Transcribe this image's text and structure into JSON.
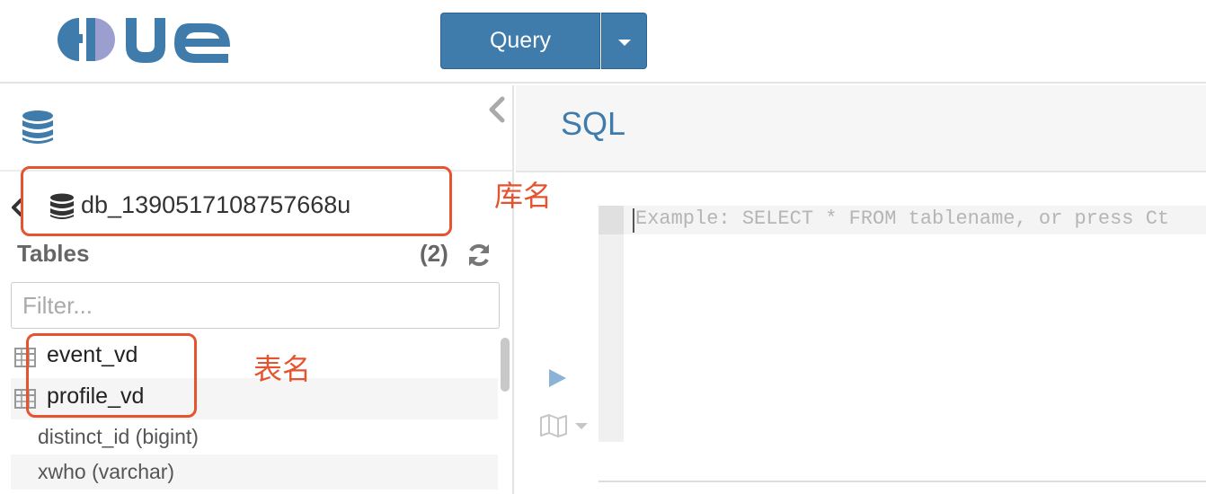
{
  "header": {
    "logo_text": "HUE",
    "query_button_label": "Query",
    "colors": {
      "brand": "#3f7bab",
      "logo_grey": "#9b9fd0"
    }
  },
  "left_panel": {
    "database_name": "db_1390517108757668u",
    "tables_title": "Tables",
    "tables_count": "(2)",
    "filter_placeholder": "Filter...",
    "tables": [
      {
        "name": "event_vd"
      },
      {
        "name": "profile_vd"
      }
    ],
    "columns": [
      {
        "label": "distinct_id (bigint)"
      },
      {
        "label": "xwho (varchar)"
      }
    ]
  },
  "editor": {
    "title": "SQL",
    "placeholder": "Example: SELECT * FROM tablename, or press Ct"
  },
  "annotations": {
    "database_label": "库名",
    "table_label": "表名",
    "color": "#e5542e"
  },
  "icons": [
    "hue-logo",
    "database-icon",
    "chevron-left-icon",
    "refresh-icon",
    "table-grid-icon",
    "play-icon",
    "map-icon",
    "caret-down-icon"
  ]
}
